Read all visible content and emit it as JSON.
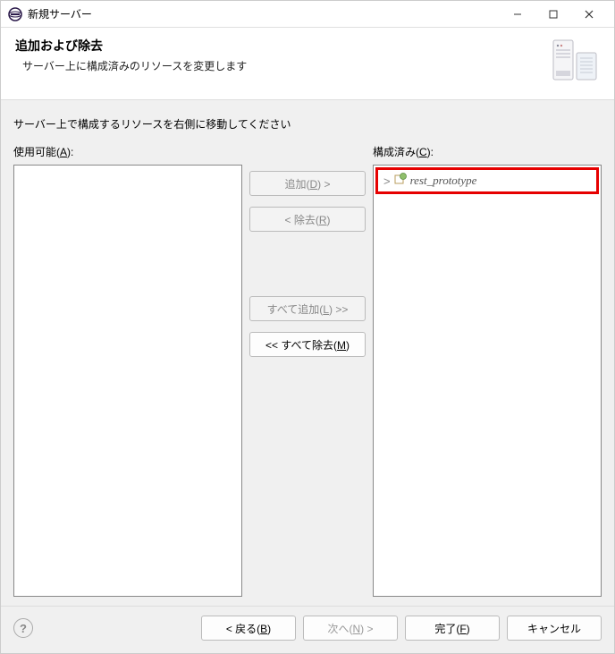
{
  "window": {
    "title": "新規サーバー"
  },
  "header": {
    "title": "追加および除去",
    "description": "サーバー上に構成済みのリソースを変更します"
  },
  "body": {
    "instruction": "サーバー上で構成するリソースを右側に移動してください",
    "available_label_prefix": "使用可能(",
    "available_label_mnemonic": "A",
    "available_label_suffix": "):",
    "configured_label_prefix": "構成済み(",
    "configured_label_mnemonic": "C",
    "configured_label_suffix": "):",
    "configured_items": {
      "0": {
        "label": "rest_prototype"
      }
    }
  },
  "buttons": {
    "add_prefix": "追加(",
    "add_mnemonic": "D",
    "add_suffix": ") >",
    "remove_prefix": "< 除去(",
    "remove_mnemonic": "R",
    "remove_suffix": ")",
    "add_all_prefix": "すべて追加(",
    "add_all_mnemonic": "L",
    "add_all_suffix": ") >>",
    "remove_all_prefix": "<< すべて除去(",
    "remove_all_mnemonic": "M",
    "remove_all_suffix": ")"
  },
  "footer": {
    "back_prefix": "< 戻る(",
    "back_mnemonic": "B",
    "back_suffix": ")",
    "next_prefix": "次へ(",
    "next_mnemonic": "N",
    "next_suffix": ") >",
    "finish_prefix": "完了(",
    "finish_mnemonic": "F",
    "finish_suffix": ")",
    "cancel": "キャンセル"
  }
}
